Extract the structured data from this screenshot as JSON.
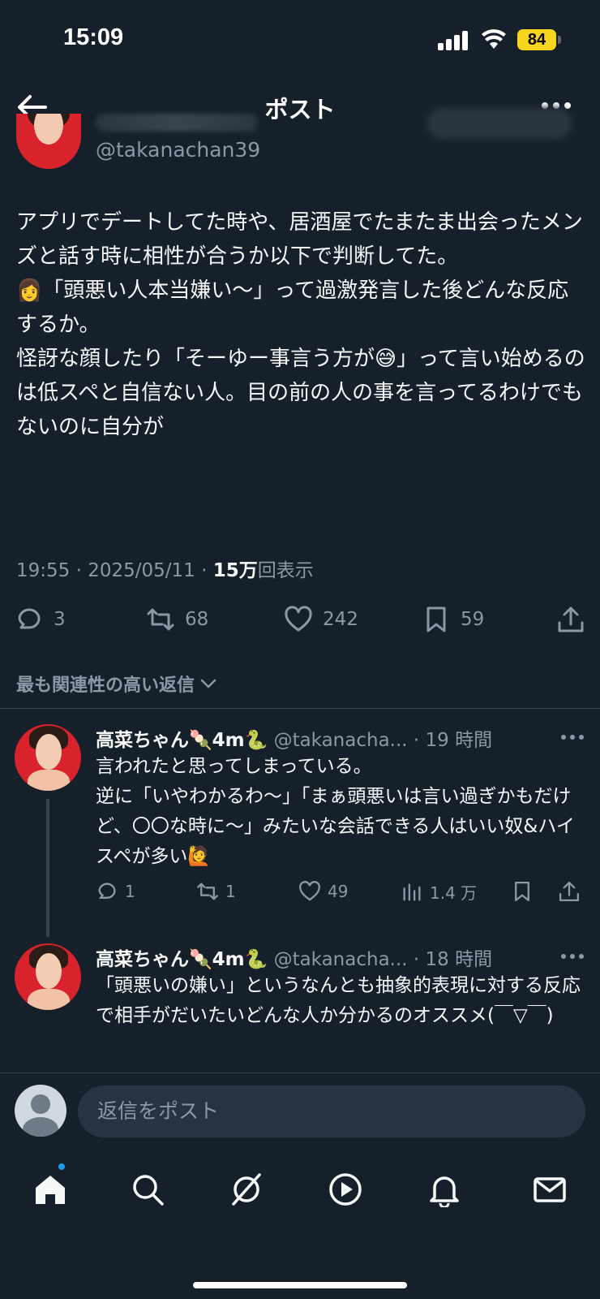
{
  "status_bar": {
    "time": "15:09",
    "battery": "84"
  },
  "header": {
    "title": "ポスト"
  },
  "post": {
    "handle": "@takanachan39",
    "text": "アプリでデートしてた時や、居酒屋でたまたま出会ったメンズと話す時に相性が合うか以下で判断してた。\n👩「頭悪い人本当嫌い〜」って過激発言した後どんな反応するか。\n怪訝な顔したり「そーゆー事言う方が😅」って言い始めるのは低スペと自信ない人。目の前の人の事を言ってるわけでもないのに自分が",
    "time": "19:55",
    "date": "2025/05/11",
    "views_count": "15万",
    "views_label": "回表示",
    "stats": {
      "replies": "3",
      "reposts": "68",
      "likes": "242",
      "bookmarks": "59"
    }
  },
  "sort_label": "最も関連性の高い返信",
  "replies": [
    {
      "name": "高菜ちゃん🍡4m🐍",
      "handle": "@takanacha...",
      "time": "19 時間",
      "text": "言われたと思ってしまっている。\n逆に「いやわかるわ〜」「まぁ頭悪いは言い過ぎかもだけど、〇〇な時に〜」みたいな会話できる人はいい奴&ハイスペが多い🙋",
      "stats": {
        "replies": "1",
        "reposts": "1",
        "likes": "49",
        "views": "1.4 万"
      }
    },
    {
      "name": "高菜ちゃん🍡4m🐍",
      "handle": "@takanacha...",
      "time": "18 時間",
      "text": "「頭悪いの嫌い」というなんとも抽象的表現に対する反応で相手がだいたいどんな人か分かるのオススメ(￣▽￣)"
    }
  ],
  "reply_bar": {
    "placeholder": "返信をポスト"
  },
  "colors": {
    "accent": "#1d9bf0",
    "background": "#15202b",
    "muted": "#8b98a5"
  }
}
